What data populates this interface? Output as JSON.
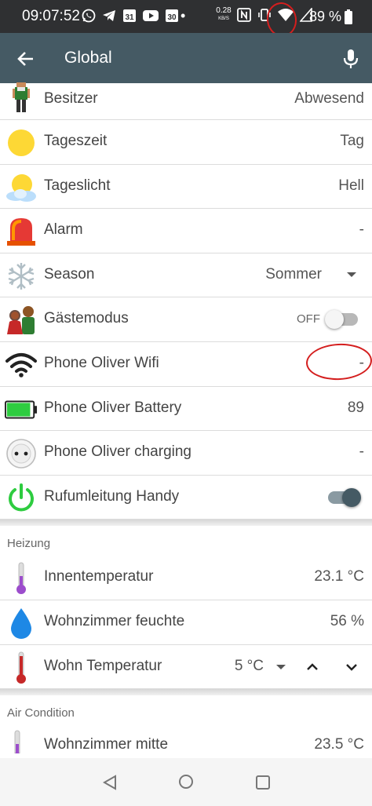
{
  "status_bar": {
    "time": "09:07:52",
    "net_speed_value": "0.28",
    "net_speed_unit": "KB/S",
    "battery_percent": "89 %",
    "icons": [
      "whatsapp-icon",
      "telegram-icon",
      "calendar-icon",
      "youtube-icon",
      "calendar-icon",
      "dot-icon",
      "net-speed",
      "nfc-icon",
      "vibrate-icon",
      "wifi-icon",
      "cell-signal-icon",
      "battery-icon"
    ],
    "calendar_1": "31",
    "calendar_2": "30"
  },
  "app_bar": {
    "title": "Global",
    "accent": "#455a64"
  },
  "items": [
    {
      "label": "Besitzer",
      "value": "Abwesend",
      "icon": "person-icon"
    },
    {
      "label": "Tageszeit",
      "value": "Tag",
      "icon": "sun-icon"
    },
    {
      "label": "Tageslicht",
      "value": "Hell",
      "icon": "sun-cloud-icon"
    },
    {
      "label": "Alarm",
      "value": "-",
      "icon": "alarm-light-icon"
    },
    {
      "label": "Season",
      "value": "Sommer",
      "icon": "snowflake-icon"
    },
    {
      "label": "Gästemodus",
      "value": "OFF",
      "icon": "guests-icon"
    },
    {
      "label": "Phone Oliver Wifi",
      "value": "-",
      "icon": "wifi-icon"
    },
    {
      "label": "Phone Oliver Battery",
      "value": "89",
      "icon": "battery-icon"
    },
    {
      "label": "Phone Oliver charging",
      "value": "-",
      "icon": "power-socket-icon"
    },
    {
      "label": "Rufumleitung Handy",
      "value": "",
      "icon": "power-button-icon"
    }
  ],
  "heizung": {
    "header": "Heizung",
    "items": [
      {
        "label": "Innentemperatur",
        "value": "23.1 °C",
        "icon": "thermometer-purple-icon"
      },
      {
        "label": "Wohnzimmer feuchte",
        "value": "56 %",
        "icon": "water-drop-icon"
      },
      {
        "label": "Wohn Temperatur",
        "value": "5 °C",
        "icon": "thermometer-red-icon"
      }
    ]
  },
  "air_condition": {
    "header": "Air Condition",
    "items": [
      {
        "label": "Wohnzimmer mitte",
        "value": "23.5 °C",
        "icon": "thermometer-purple-icon"
      }
    ]
  }
}
